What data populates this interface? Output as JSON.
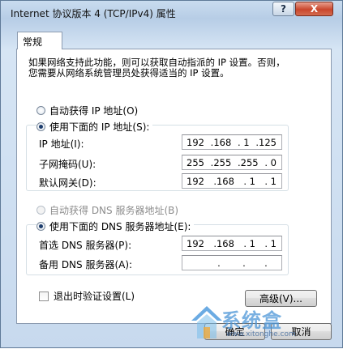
{
  "window": {
    "title": "Internet 协议版本 4 (TCP/IPv4) 属性",
    "help_label": "?",
    "close_label": "X"
  },
  "tab": {
    "label": "常规"
  },
  "description": {
    "line1": "如果网络支持此功能，则可以获取自动指派的 IP 设置。否则，",
    "line2": "您需要从网络系统管理员处获得适当的 IP 设置。"
  },
  "ip": {
    "auto_label": "自动获得 IP 地址(O)",
    "auto_checked": false,
    "manual_label": "使用下面的 IP 地址(S):",
    "manual_checked": true,
    "address_label": "IP 地址(I):",
    "address": {
      "o1": "192",
      "o2": ".168",
      "o3": ". 1",
      "o4": ".125"
    },
    "subnet_label": "子网掩码(U):",
    "subnet": {
      "o1": "255",
      "o2": ".255",
      "o3": ".255",
      "o4": ". 0"
    },
    "gateway_label": "默认网关(D):",
    "gateway": {
      "o1": "192",
      "o2": ".168",
      "o3": ". 1",
      "o4": ". 1"
    }
  },
  "dns": {
    "auto_label": "自动获得 DNS 服务器地址(B)",
    "auto_checked": false,
    "manual_label": "使用下面的 DNS 服务器地址(E):",
    "manual_checked": true,
    "preferred_label": "首选 DNS 服务器(P):",
    "preferred": {
      "o1": "192",
      "o2": ".168",
      "o3": ". 1",
      "o4": ". 1"
    },
    "alternate_label": "备用 DNS 服务器(A):",
    "alternate": {
      "o1": "",
      "o2": ".",
      "o3": ".",
      "o4": "."
    }
  },
  "validate_label": "退出时验证设置(L)",
  "validate_checked": false,
  "buttons": {
    "advanced": "高级(V)...",
    "ok": "确定",
    "cancel": "取消"
  },
  "watermark": {
    "text": "系统盒",
    "url": "www.xitonghe.com"
  }
}
